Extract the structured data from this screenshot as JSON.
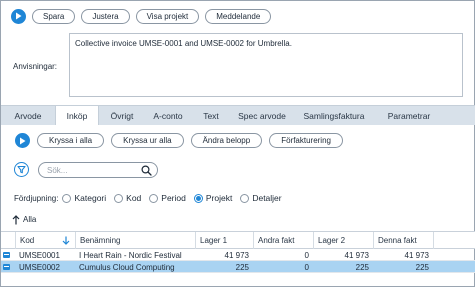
{
  "toolbar": {
    "buttons": [
      "Spara",
      "Justera",
      "Visa projekt",
      "Meddelande"
    ]
  },
  "notes": {
    "label": "Anvisningar:",
    "value": "Collective invoice UMSE-0001 and UMSE-0002 for Umbrella."
  },
  "tabs": [
    "Arvode",
    "Inköp",
    "Övrigt",
    "A-conto",
    "Text",
    "Spec arvode",
    "Samlingsfaktura",
    "Parametrar"
  ],
  "active_tab": "Inköp",
  "subtoolbar": {
    "buttons": [
      "Kryssa i alla",
      "Kryssa ur alla",
      "Ändra belopp",
      "Förfakturering"
    ]
  },
  "search": {
    "placeholder": "Sök..."
  },
  "grouping": {
    "label": "Fördjupning:",
    "options": [
      "Kategori",
      "Kod",
      "Period",
      "Projekt",
      "Detaljer"
    ],
    "selected": "Projekt"
  },
  "alla_label": "Alla",
  "table": {
    "headers": [
      "Kod",
      "Benämning",
      "Lager 1",
      "Andra fakt",
      "Lager 2",
      "Denna fakt"
    ],
    "rows": [
      [
        "UMSE0001",
        "I Heart Rain - Nordic Festival",
        "41 973",
        "0",
        "41 973",
        "41 973"
      ],
      [
        "UMSE0002",
        "Cumulus Cloud Computing",
        "225",
        "0",
        "225",
        "225"
      ]
    ],
    "selected_row": 1
  },
  "colors": {
    "accent": "#1f86d6",
    "selected_row": "#a9d3f2",
    "tab_bar": "#d8e1ea"
  }
}
